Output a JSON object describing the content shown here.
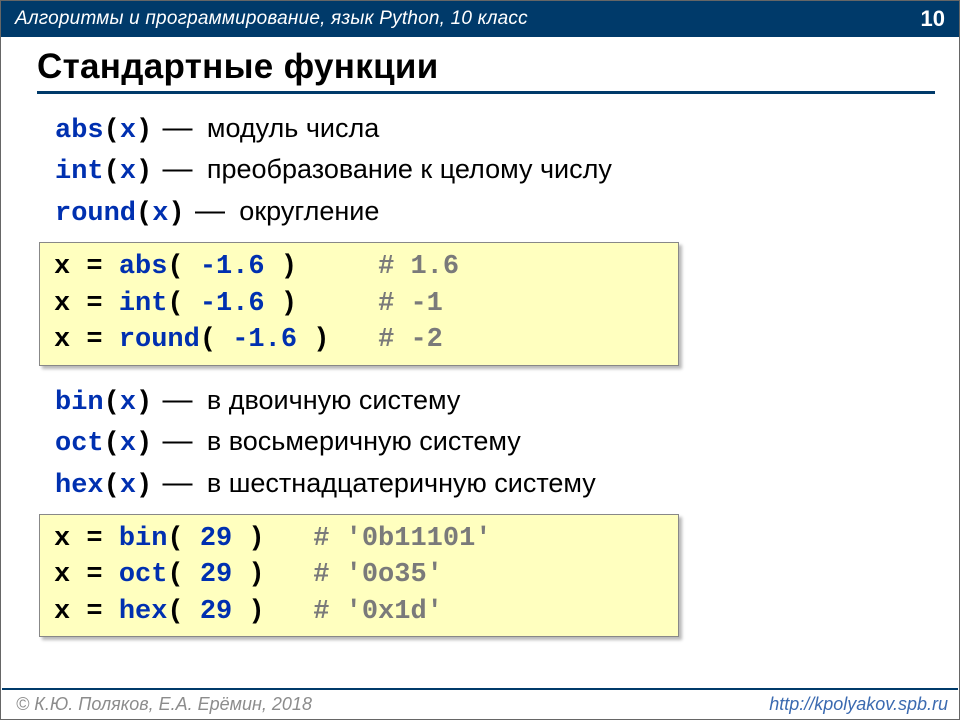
{
  "header": {
    "title": "Алгоритмы и программирование, язык Python, 10 класс",
    "page_number": "10"
  },
  "title": "Стандартные функции",
  "defs1": [
    {
      "fn": "abs",
      "arg": "x",
      "desc": "модуль числа"
    },
    {
      "fn": "int",
      "arg": "x",
      "desc": "преобразование к целому числу"
    },
    {
      "fn": "round",
      "arg": "x",
      "desc": "округление"
    }
  ],
  "code1": [
    {
      "var": "x",
      "fn": "abs",
      "arg": "-1.6",
      "comment": "# 1.6"
    },
    {
      "var": "x",
      "fn": "int",
      "arg": "-1.6",
      "comment": "# -1"
    },
    {
      "var": "x",
      "fn": "round",
      "arg": "-1.6",
      "comment": "# -2"
    }
  ],
  "defs2": [
    {
      "fn": "bin",
      "arg": "x",
      "desc": "в двоичную систему"
    },
    {
      "fn": "oct",
      "arg": "x",
      "desc": "в восьмеричную систему"
    },
    {
      "fn": "hex",
      "arg": "x",
      "desc": "в шестнадцатеричную систему"
    }
  ],
  "code2": [
    {
      "var": "x",
      "fn": "bin",
      "arg": "29",
      "comment": "# '0b11101'"
    },
    {
      "var": "x",
      "fn": "oct",
      "arg": "29",
      "comment": "# '0o35'"
    },
    {
      "var": "x",
      "fn": "hex",
      "arg": "29",
      "comment": "# '0x1d'"
    }
  ],
  "footer": {
    "copyright": "© К.Ю. Поляков, Е.А. Ерёмин, 2018",
    "url": "http://kpolyakov.spb.ru"
  },
  "dash": "—"
}
